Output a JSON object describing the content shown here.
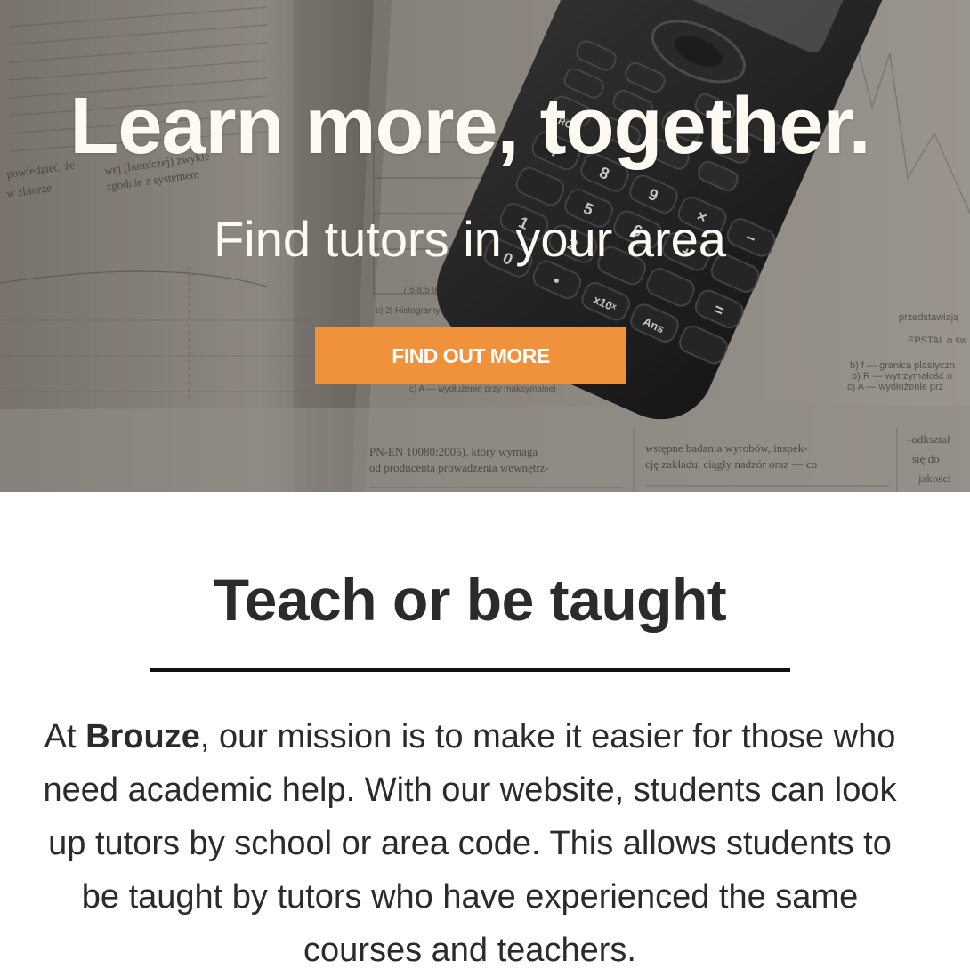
{
  "hero": {
    "title": "Learn more, together.",
    "subtitle": "Find tutors in your area",
    "cta_label": "FIND OUT MORE",
    "background_image": "calculator-on-open-textbook",
    "cta_color": "#f0913b",
    "background_texts": {
      "left_page_1": "wej (hutniczej) zwykle",
      "left_page_2": "zgodnie z systemem",
      "left_page_3": "powiedzieć, że",
      "left_page_4": "w zbiorze",
      "figure_caption": "c) 2| Histogramy przedstawiające",
      "axis_ticks": "7,5  8,5  9,5  10,5  11,5  12,5",
      "right_page_1": "przedstawiają",
      "right_page_2": "EPSTAL o św",
      "right_page_3": "b) f — granica plastyczn",
      "right_page_4": "b) R — wytrzymałość n",
      "right_page_5": "c) A — wydłużenie prz",
      "caption_mid": "c) A — wydłużenie przy maksymalnej",
      "bottom_1": "PN-EN 10080:2005), który wymaga",
      "bottom_2": "od producenta prowadzenia wewnętrz-",
      "bottom_3": "wstępne badania wyrobów, inspek-",
      "bottom_4": "cję zakładu, ciągły nadzór oraz — co",
      "bottom_5": "-odkształ",
      "bottom_6": "się do",
      "bottom_7": "jakości",
      "calc_keys": [
        "7",
        "8",
        "9",
        "×",
        "−",
        "5",
        "6",
        "+",
        "RCL",
        "1",
        "2",
        "=",
        "0",
        "•",
        "x10ˣ",
        "Ans"
      ]
    }
  },
  "about": {
    "title": "Teach or be taught",
    "text_before": "At ",
    "brand": "Brouze",
    "text_after": ", our mission is to make it easier for those who need academic help. With our website, students can look up tutors by school or area code. This allows students to be taught by tutors who have experienced the same courses and teachers."
  }
}
